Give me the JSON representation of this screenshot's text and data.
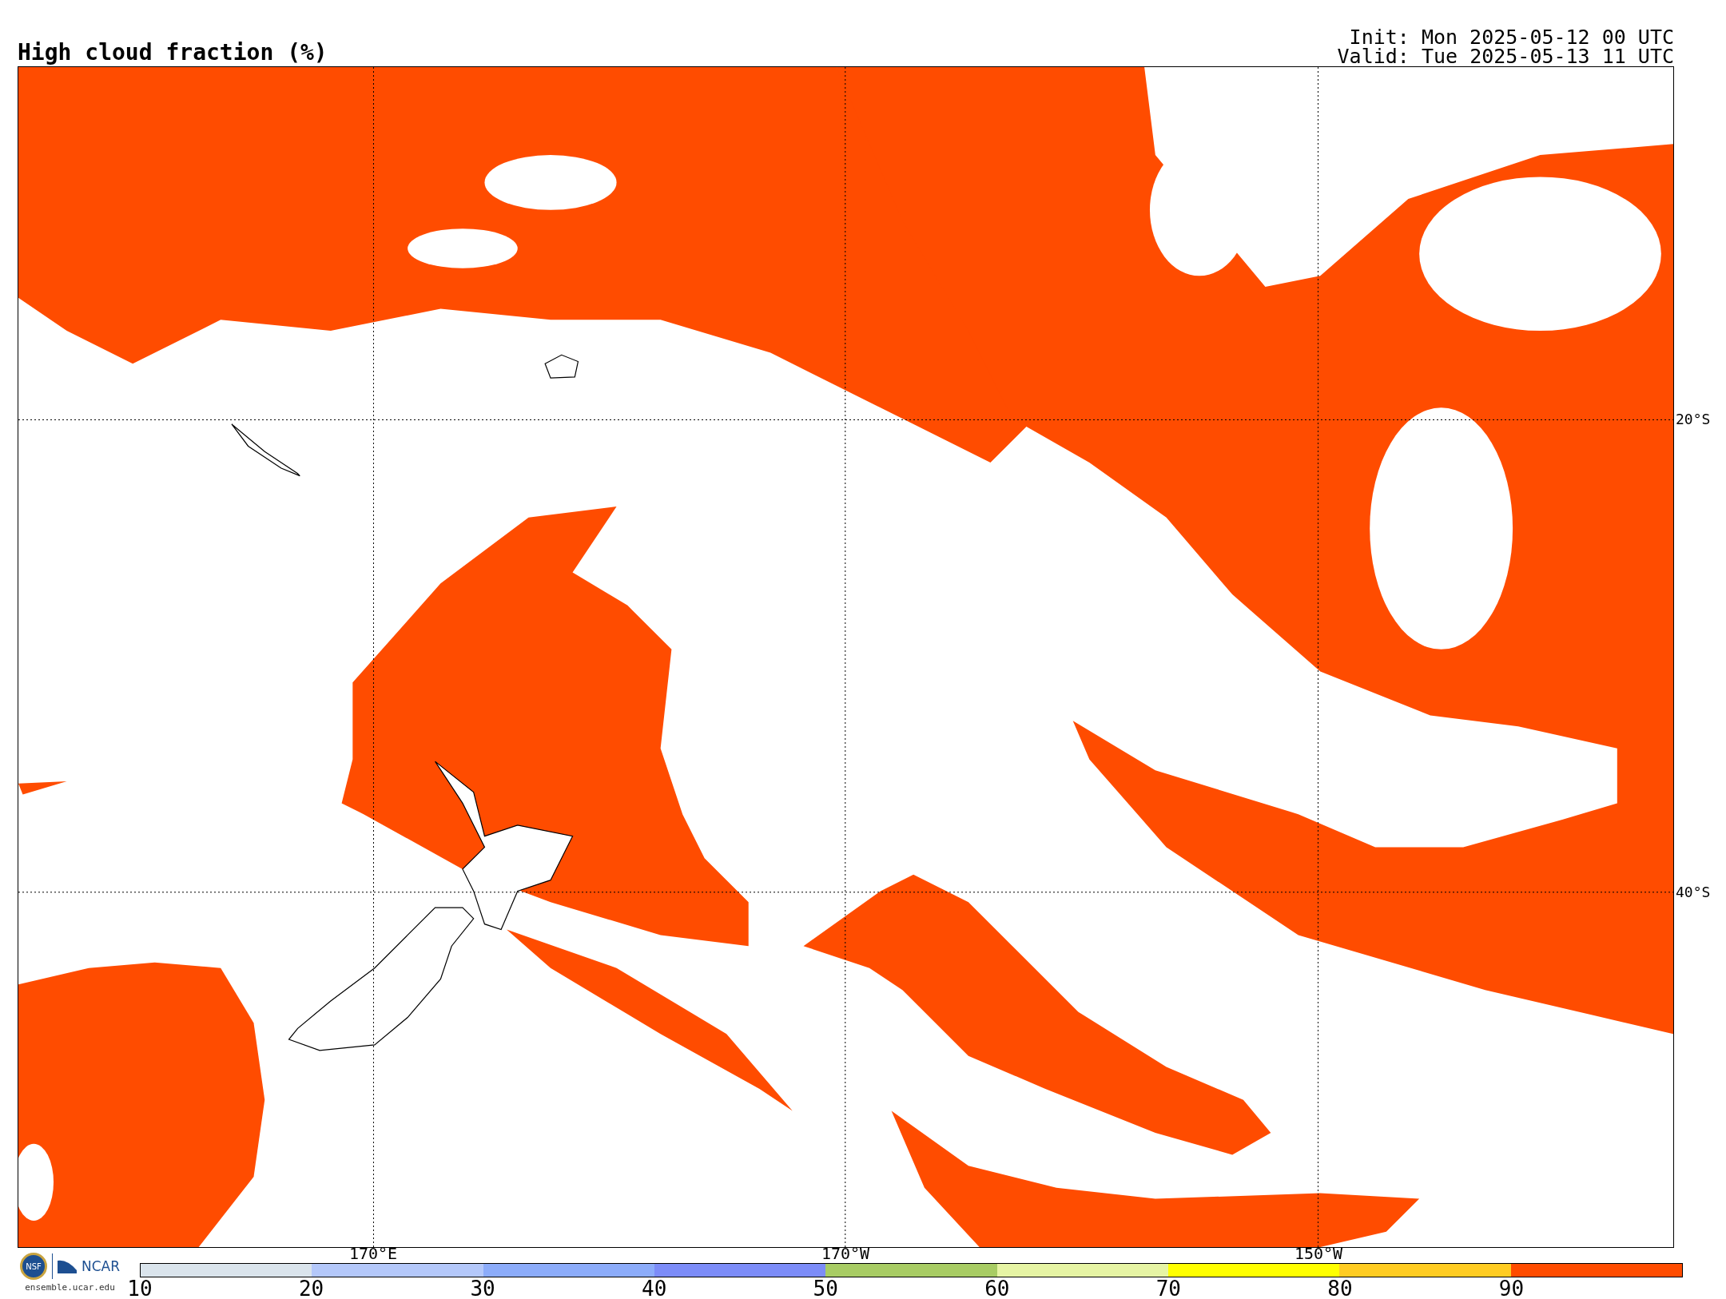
{
  "header": {
    "title": "High cloud fraction (%)",
    "init": "Init: Mon 2025-05-12 00 UTC",
    "valid": "Valid: Tue 2025-05-13 11 UTC"
  },
  "map": {
    "lat_labels": [
      "20°S",
      "40°S"
    ],
    "lon_labels": [
      "170°E",
      "170°W",
      "150°W"
    ]
  },
  "colorbar": {
    "bins": [
      {
        "color": "#dae4ec",
        "tick": "10"
      },
      {
        "color": "#b4c8fa",
        "tick": "20"
      },
      {
        "color": "#8cacfa",
        "tick": "30"
      },
      {
        "color": "#7c8cf8",
        "tick": "40"
      },
      {
        "color": "#a8cc64",
        "tick": "50"
      },
      {
        "color": "#e6f4a4",
        "tick": "60"
      },
      {
        "color": "#ffff00",
        "tick": "70"
      },
      {
        "color": "#ffcc22",
        "tick": "80"
      },
      {
        "color": "#ff4c00",
        "tick": "90"
      }
    ]
  },
  "footer": {
    "logo_seal": "NSF",
    "logo_text": "NCAR",
    "credit": "ensemble.ucar.edu"
  }
}
